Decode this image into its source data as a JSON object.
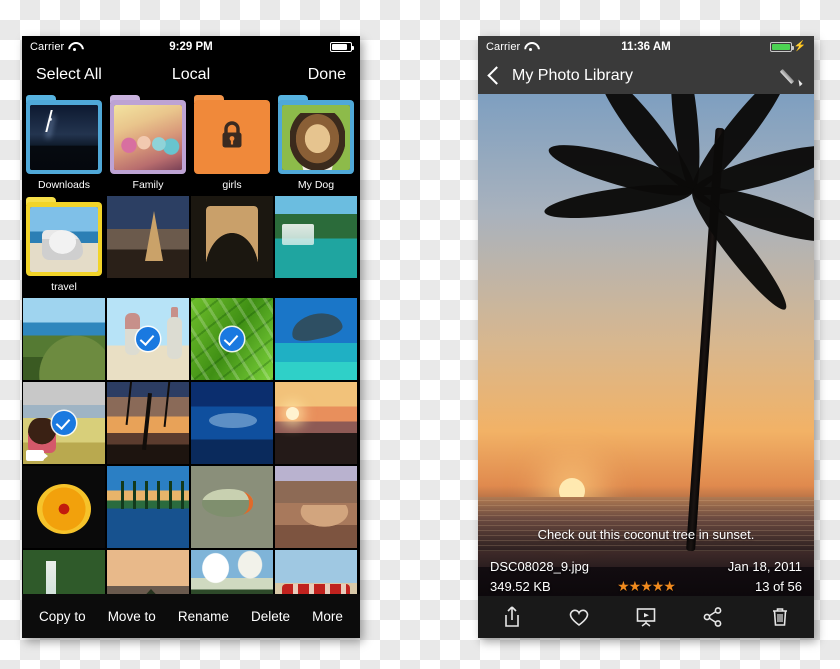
{
  "left_phone": {
    "status_bar": {
      "carrier": "Carrier",
      "wifi_icon": "wifi-icon",
      "time": "9:29 PM",
      "battery_icon": "battery-full-icon"
    },
    "nav_bar": {
      "left_button": "Select All",
      "title": "Local",
      "right_button": "Done"
    },
    "grid": {
      "rows": [
        {
          "type": "folders",
          "items": [
            {
              "label": "Downloads",
              "folder_color": "#4fa8d8",
              "locked": false,
              "art": "p-storm"
            },
            {
              "label": "Family",
              "folder_color": "#bda3d4",
              "locked": false,
              "art": "p-party"
            },
            {
              "label": "girls",
              "folder_color": "#f0893a",
              "locked": true,
              "art": ""
            },
            {
              "label": "My Dog",
              "folder_color": "#4fa8d8",
              "locked": false,
              "art": "p-dog"
            }
          ]
        },
        {
          "type": "mixed",
          "items": [
            {
              "kind": "folder",
              "label": "travel",
              "folder_color": "#f2d429",
              "locked": false,
              "art": "p-surf"
            },
            {
              "kind": "photo",
              "art": "p-eiffel",
              "selected": false
            },
            {
              "kind": "photo",
              "art": "p-arc",
              "selected": false
            },
            {
              "kind": "photo",
              "art": "p-falls",
              "selected": false
            }
          ]
        },
        {
          "type": "photos",
          "items": [
            {
              "art": "p-coast",
              "selected": false,
              "video": false
            },
            {
              "art": "p-jump",
              "selected": true,
              "video": false
            },
            {
              "art": "p-aloe",
              "selected": true,
              "video": false
            },
            {
              "art": "p-ray",
              "selected": false,
              "video": false
            }
          ]
        },
        {
          "type": "photos",
          "items": [
            {
              "art": "p-bus",
              "selected": true,
              "video": true
            },
            {
              "art": "p-palm",
              "selected": false,
              "video": false
            },
            {
              "art": "p-whale",
              "selected": false,
              "video": false
            },
            {
              "art": "p-sunset1",
              "selected": false,
              "video": false
            }
          ]
        },
        {
          "type": "photos",
          "items": [
            {
              "art": "p-flower",
              "selected": false,
              "video": false
            },
            {
              "art": "p-reflect",
              "selected": false,
              "video": false
            },
            {
              "art": "p-fish",
              "selected": false,
              "video": false
            },
            {
              "art": "p-crater",
              "selected": false,
              "video": false
            }
          ]
        },
        {
          "type": "photos",
          "items": [
            {
              "art": "p-wfall",
              "selected": false,
              "video": false
            },
            {
              "art": "p-mtn",
              "selected": false,
              "video": false
            },
            {
              "art": "p-beach",
              "selected": false,
              "video": false
            },
            {
              "art": "p-red",
              "selected": false,
              "video": false
            }
          ]
        }
      ]
    },
    "toolbar": {
      "buttons": [
        "Copy to",
        "Move to",
        "Rename",
        "Delete",
        "More"
      ]
    }
  },
  "right_phone": {
    "status_bar": {
      "carrier": "Carrier",
      "wifi_icon": "wifi-icon",
      "time": "11:36 AM",
      "battery_icon": "battery-charging-icon",
      "battery_color": "#4cd353"
    },
    "nav_bar": {
      "back_icon": "back-chevron-icon",
      "title": "My Photo Library",
      "right_icon": "pencil-icon"
    },
    "photo_info": {
      "caption": "Check out this coconut tree in sunset.",
      "filename": "DSC08028_9.jpg",
      "date": "Jan 18, 2011",
      "filesize": "349.52 KB",
      "rating": "★★★★★",
      "rating_value": 5,
      "position": "13 of 56",
      "star_color": "#f08a1e"
    },
    "toolbar": {
      "icons": [
        "share-icon",
        "heart-icon",
        "slideshow-icon",
        "share-nodes-icon",
        "trash-icon"
      ]
    }
  },
  "colors": {
    "selection_blue": "#1a79e0",
    "nav_dark": "#3a3a3a",
    "black": "#000000"
  }
}
